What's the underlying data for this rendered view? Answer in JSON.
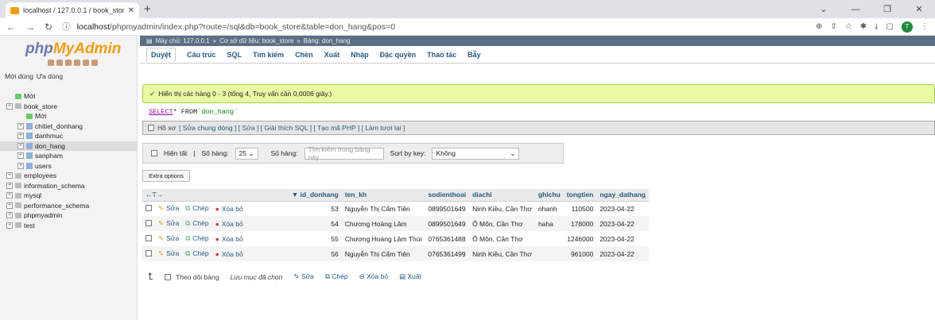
{
  "browser": {
    "tab_title": "localhost / 127.0.0.1 / book_store",
    "url_host": "localhost",
    "url_path": "/phpmyadmin/index.php?route=/sql&db=book_store&table=don_hang&pos=0",
    "avatar_letter": "T"
  },
  "sidebar": {
    "logo_a": "php",
    "logo_b": "MyAdmin",
    "tab_recent": "Mới dùng",
    "tab_fav": "Ưa dùng",
    "items": [
      {
        "label": "Mới",
        "level": 0,
        "type": "new"
      },
      {
        "label": "book_store",
        "level": 0,
        "type": "db"
      },
      {
        "label": "Mới",
        "level": 1,
        "type": "new"
      },
      {
        "label": "chitiet_donhang",
        "level": 1,
        "type": "table"
      },
      {
        "label": "danhmuc",
        "level": 1,
        "type": "table"
      },
      {
        "label": "don_hang",
        "level": 1,
        "type": "table",
        "selected": true
      },
      {
        "label": "sanpham",
        "level": 1,
        "type": "table"
      },
      {
        "label": "users",
        "level": 1,
        "type": "table"
      },
      {
        "label": "employees",
        "level": 0,
        "type": "db"
      },
      {
        "label": "information_schema",
        "level": 0,
        "type": "db"
      },
      {
        "label": "mysql",
        "level": 0,
        "type": "db"
      },
      {
        "label": "performance_schema",
        "level": 0,
        "type": "db"
      },
      {
        "label": "phpmyadmin",
        "level": 0,
        "type": "db"
      },
      {
        "label": "test",
        "level": 0,
        "type": "db"
      }
    ]
  },
  "breadcrumb": {
    "server": "Máy chủ: 127.0.0.1",
    "db": "Cơ sở dữ liệu: book_store",
    "table": "Bảng: don_hang"
  },
  "menu": [
    "Duyệt",
    "Cấu trúc",
    "SQL",
    "Tìm kiếm",
    "Chèn",
    "Xuất",
    "Nhập",
    "Đặc quyền",
    "Thao tác",
    "Bẫy"
  ],
  "success_msg": "Hiển thị các hàng 0 - 3 (tổng 4, Truy vấn cần 0,0006 giây.)",
  "sql": {
    "kw": "SELECT",
    "rest": " * FROM ",
    "str": "`don_hang`"
  },
  "profile": {
    "label": "Hồ sơ",
    "links": "[ Sửa chung dòng ] [ Sửa ] [ Giải thích SQL ] [ Tạo mã PHP ] [ Làm tươi lại ]"
  },
  "controls": {
    "show_all": "Hiện tất",
    "rows_label": "Số hàng:",
    "rows_value": "25",
    "rows_label2": "Số hàng:",
    "filter_placeholder": "Tìm kiếm trong bảng này",
    "sort_label": "Sort by key:",
    "sort_value": "Không"
  },
  "extra_options": "Extra options",
  "table": {
    "headers": [
      "id_donhang",
      "ten_kh",
      "sodienthoai",
      "diachi",
      "ghichu",
      "tongtien",
      "ngay_dathang"
    ],
    "actions": {
      "edit": "Sửa",
      "copy": "Chép",
      "del": "Xóa bỏ"
    },
    "rows": [
      [
        "53",
        "Nguyễn Thị Cẩm Tiên",
        "0899501649",
        "Ninh Kiều, Cần Thơ",
        "nhanh",
        "110500",
        "2023-04-22"
      ],
      [
        "54",
        "Chương Hoàng Lâm",
        "0899501649",
        "Ô Môn, Cần Thơ",
        "haha",
        "178000",
        "2023-04-22"
      ],
      [
        "55",
        "Chương Hoàng Lâm Thúi",
        "0765361488",
        "Ô Môn, Cần Thơ",
        "",
        "1246000",
        "2023-04-22"
      ],
      [
        "56",
        "Nguyễn Thị Cẩm Tiên",
        "0765361499",
        "Ninh Kiều, Cần Thơ",
        "",
        "961000",
        "2023-04-22"
      ]
    ]
  },
  "footer": {
    "check_all": "Theo dõi bảng",
    "with_selected": "Lưu mục đã chọn",
    "edit": "Sửa",
    "copy": "Chép",
    "del": "Xóa bỏ",
    "export": "Xuất"
  }
}
